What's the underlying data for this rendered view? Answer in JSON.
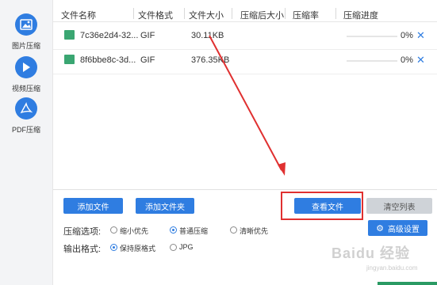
{
  "sidebar": {
    "items": [
      {
        "label": "图片压缩",
        "icon": "image-icon"
      },
      {
        "label": "视频压缩",
        "icon": "play-icon"
      },
      {
        "label": "PDF压缩",
        "icon": "pdf-icon"
      }
    ]
  },
  "table": {
    "headers": [
      "文件名称",
      "文件格式",
      "文件大小",
      "压缩后大小",
      "压缩率",
      "压缩进度"
    ],
    "rows": [
      {
        "name": "7c36e2d4-32...",
        "format": "GIF",
        "size": "30.11KB",
        "compressed": "",
        "ratio": "",
        "progress": 0,
        "progress_text": "0%"
      },
      {
        "name": "8f6bbe8c-3d...",
        "format": "GIF",
        "size": "376.35KB",
        "compressed": "",
        "ratio": "",
        "progress": 0,
        "progress_text": "0%"
      }
    ]
  },
  "buttons": {
    "add_file": "添加文件",
    "add_folder": "添加文件夹",
    "view_files": "查看文件",
    "clear_list": "清空列表",
    "advanced": "高级设置"
  },
  "options": {
    "compress_label": "压缩选项:",
    "compress_choices": [
      {
        "label": "缩小优先",
        "selected": false
      },
      {
        "label": "普通压缩",
        "selected": true
      },
      {
        "label": "清晰优先",
        "selected": false
      }
    ],
    "output_label": "输出格式:",
    "output_choices": [
      {
        "label": "保持原格式",
        "selected": true
      },
      {
        "label": "JPG",
        "selected": false
      }
    ]
  },
  "watermark": {
    "main": "Baidu 经验",
    "sub": "jingyan.baidu.com"
  },
  "colors": {
    "accent": "#2f7de1",
    "highlight": "#e03030",
    "arrow": "#e03030"
  }
}
